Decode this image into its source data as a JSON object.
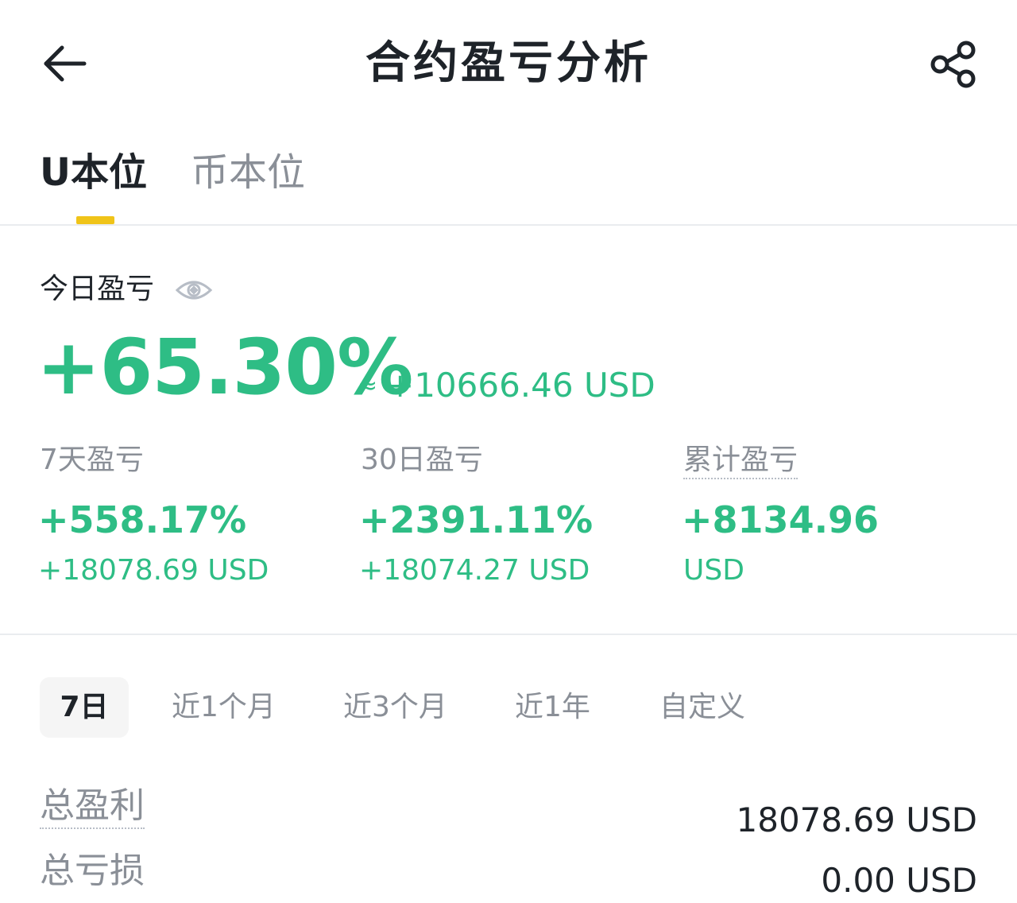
{
  "header": {
    "title": "合约盈亏分析",
    "back_icon": "arrow-left-icon",
    "share_icon": "share-icon"
  },
  "tabs": [
    {
      "label": "U本位",
      "active": true
    },
    {
      "label": "币本位",
      "active": false
    }
  ],
  "today": {
    "label": "今日盈亏",
    "eye_icon": "eye-icon",
    "percent": "+65.30%",
    "approx": "≈",
    "usd": "+10666.46 USD"
  },
  "stats": [
    {
      "label": "7天盈亏",
      "percent": "+558.17%",
      "usd": "+18078.69 USD"
    },
    {
      "label": "30日盈亏",
      "percent": "+2391.11%",
      "usd": "+18074.27 USD"
    },
    {
      "label": "累计盈亏",
      "value": "+8134.96",
      "unit": "USD"
    }
  ],
  "periods": [
    "7日",
    "近1个月",
    "近3个月",
    "近1年",
    "自定义"
  ],
  "summary": [
    {
      "label": "总盈利",
      "value": "18078.69 USD"
    },
    {
      "label": "总亏损",
      "value": "0.00 USD"
    }
  ],
  "colors": {
    "positive": "#2ebd85",
    "accent": "#f0c419",
    "muted": "#8a8f97",
    "text": "#1e2329"
  }
}
